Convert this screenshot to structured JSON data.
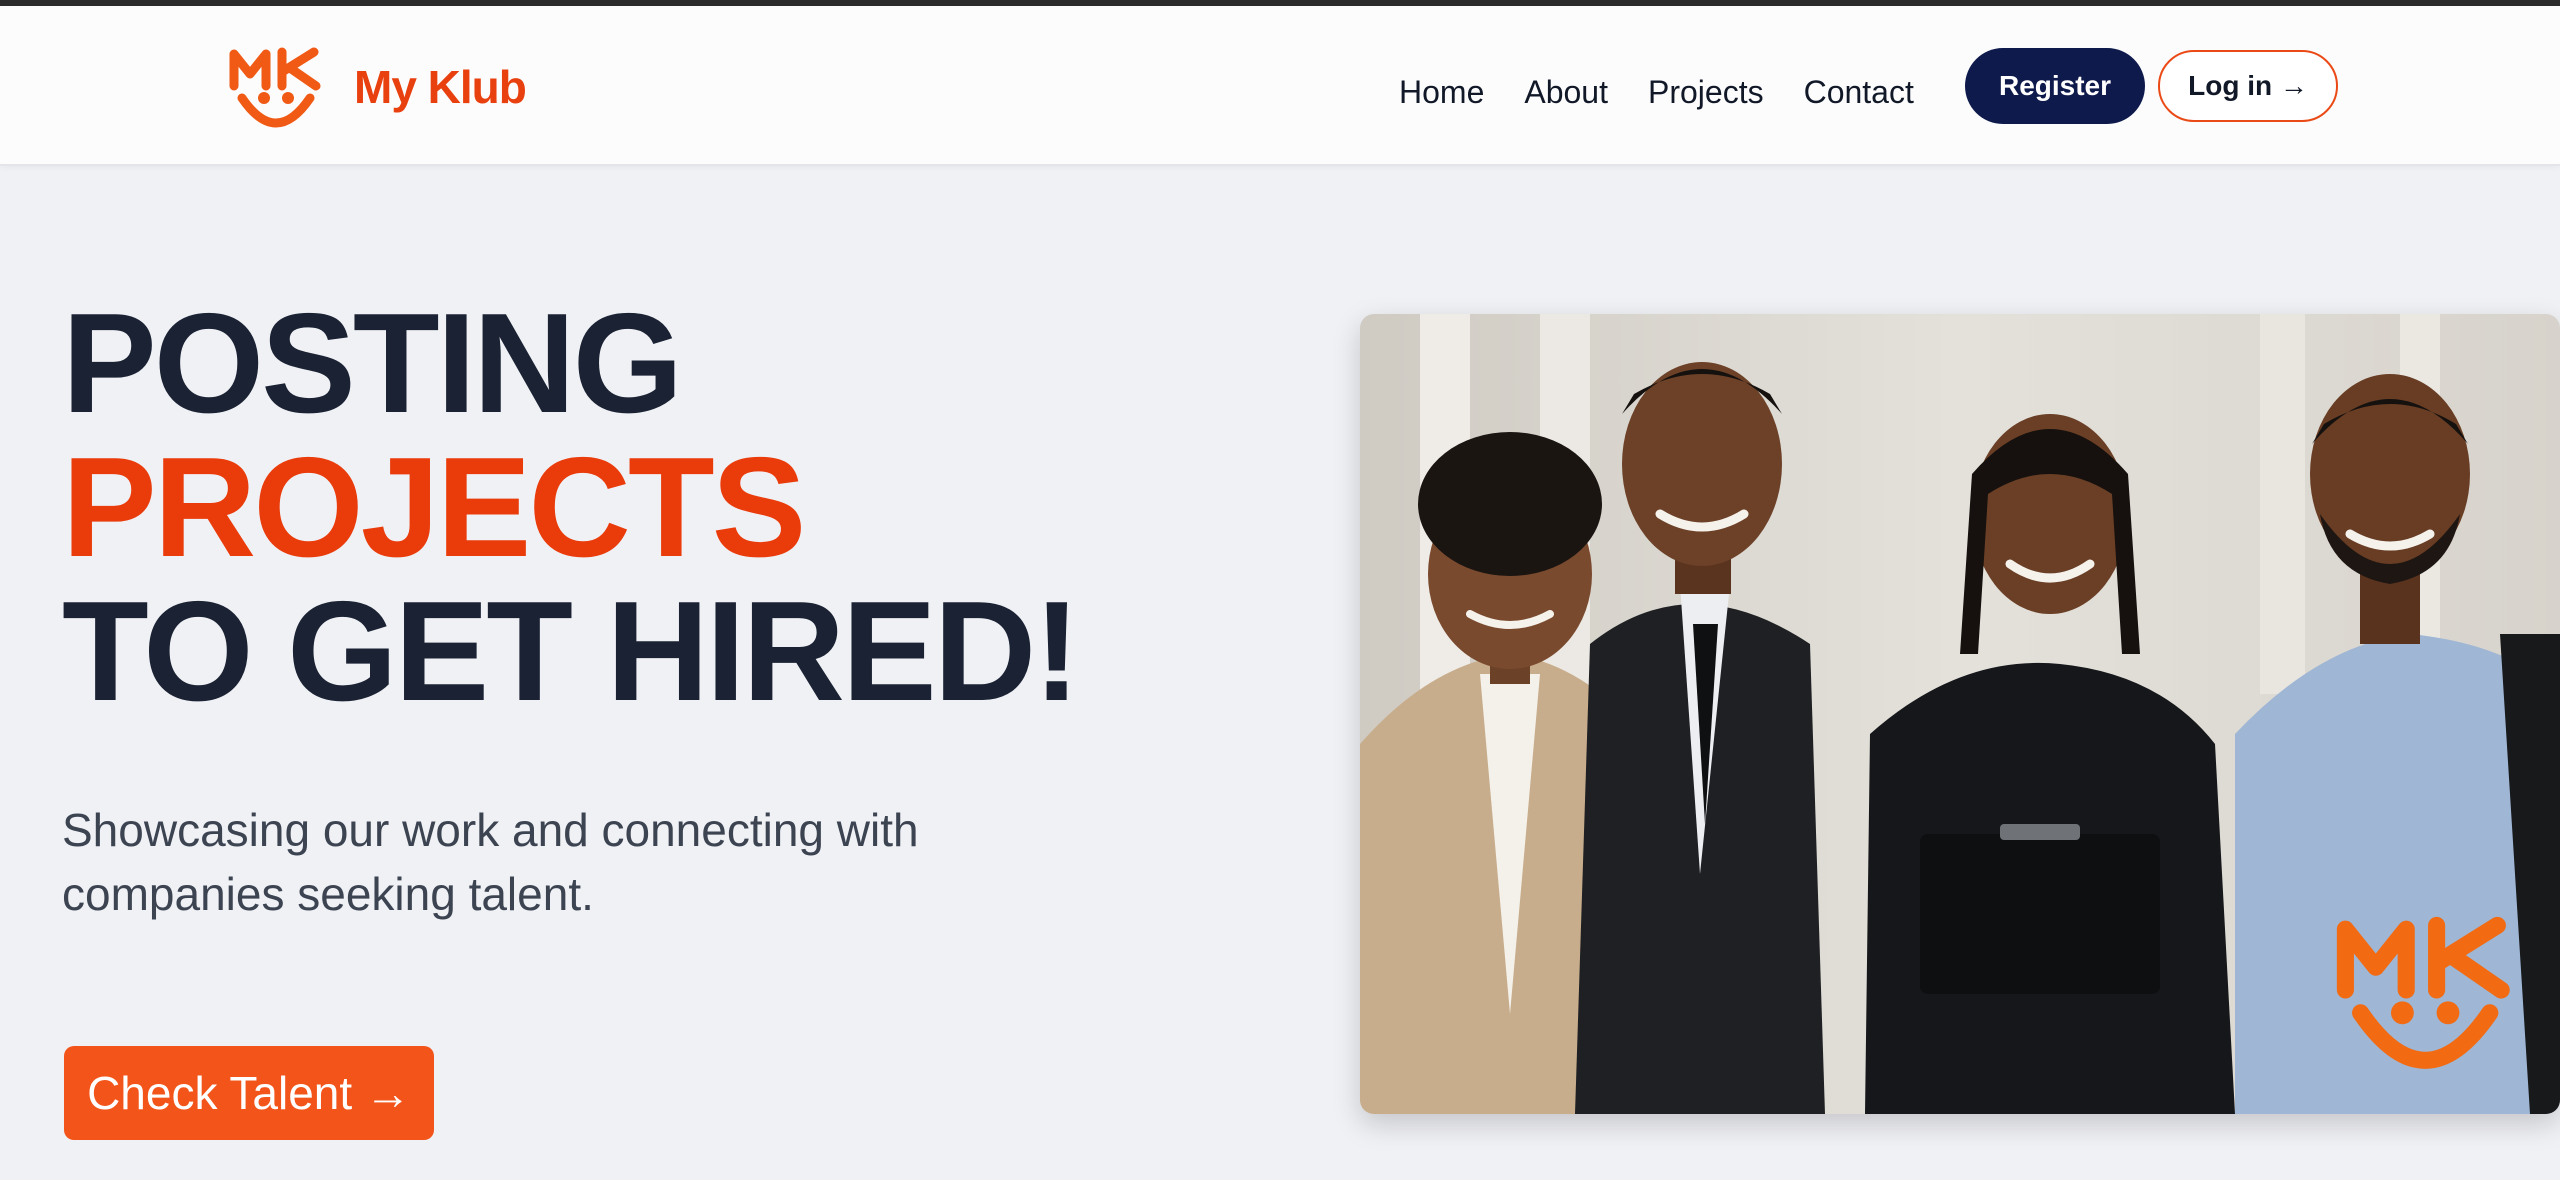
{
  "brand": {
    "name": "My Klub",
    "logo_icon": "mk-smiley-logo-icon",
    "color": "#e8410f"
  },
  "nav": {
    "links": [
      {
        "label": "Home"
      },
      {
        "label": "About"
      },
      {
        "label": "Projects"
      },
      {
        "label": "Contact"
      }
    ],
    "register_label": "Register",
    "login_label": "Log in →"
  },
  "hero": {
    "title_line_1": "POSTING",
    "title_line_2": "PROJECTS",
    "title_line_3": "TO GET HIRED!",
    "subtitle": "Showcasing our work and connecting with companies seeking talent.",
    "cta_label": "Check Talent →",
    "image_icon": "team-photo-with-mk-logo"
  },
  "colors": {
    "accent": "#ea3b0a",
    "navy": "#0e1a4b",
    "heading": "#1a2233",
    "background": "#f0f1f5"
  }
}
